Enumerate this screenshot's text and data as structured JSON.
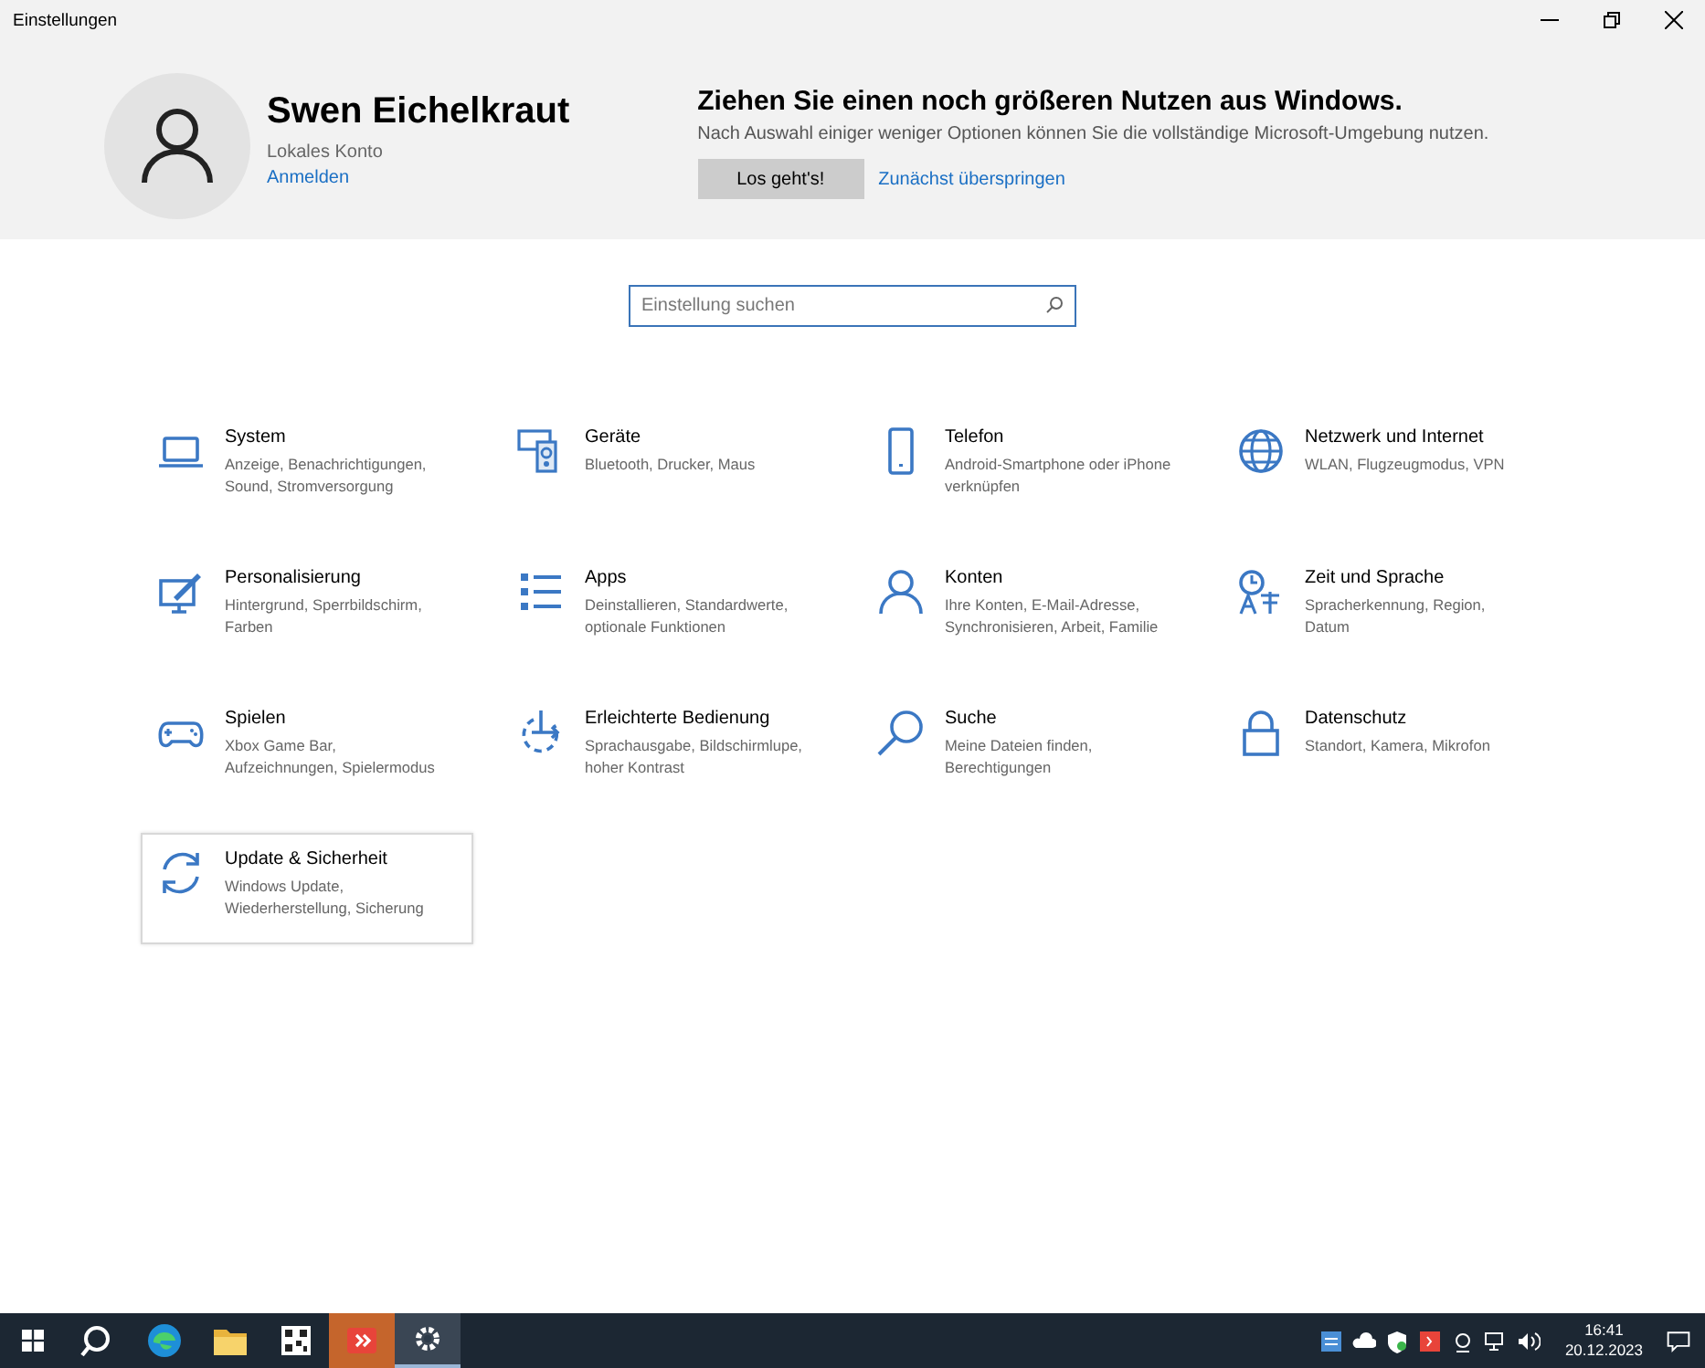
{
  "window": {
    "title": "Einstellungen"
  },
  "account": {
    "name": "Swen Eichelkraut",
    "type": "Lokales Konto",
    "link": "Anmelden"
  },
  "promo": {
    "title": "Ziehen Sie einen noch größeren Nutzen aus Windows.",
    "text": "Nach Auswahl einiger weniger Optionen können Sie die vollständige Microsoft-Umgebung nutzen.",
    "primary": "Los geht's!",
    "secondary": "Zunächst überspringen"
  },
  "search": {
    "placeholder": "Einstellung suchen"
  },
  "tiles": [
    {
      "title": "System",
      "description": "Anzeige, Benachrichtigungen, Sound, Stromversorgung",
      "hovered": false
    },
    {
      "title": "Geräte",
      "description": "Bluetooth, Drucker, Maus",
      "hovered": false
    },
    {
      "title": "Telefon",
      "description": "Android-Smartphone oder iPhone verknüpfen",
      "hovered": false
    },
    {
      "title": "Netzwerk und Internet",
      "description": "WLAN, Flugzeugmodus, VPN",
      "hovered": false
    },
    {
      "title": "Personalisierung",
      "description": "Hintergrund, Sperrbildschirm, Farben",
      "hovered": false
    },
    {
      "title": "Apps",
      "description": "Deinstallieren, Standardwerte, optionale Funktionen",
      "hovered": false
    },
    {
      "title": "Konten",
      "description": "Ihre Konten, E-Mail-Adresse, Synchronisieren, Arbeit, Familie",
      "hovered": false
    },
    {
      "title": "Zeit und Sprache",
      "description": "Spracherkennung, Region, Datum",
      "hovered": false
    },
    {
      "title": "Spielen",
      "description": "Xbox Game Bar, Aufzeichnungen, Spielermodus",
      "hovered": false
    },
    {
      "title": "Erleichterte Bedienung",
      "description": "Sprachausgabe, Bildschirmlupe, hoher Kontrast",
      "hovered": false
    },
    {
      "title": "Suche",
      "description": "Meine Dateien finden, Berechtigungen",
      "hovered": false
    },
    {
      "title": "Datenschutz",
      "description": "Standort, Kamera, Mikrofon",
      "hovered": false
    },
    {
      "title": "Update & Sicherheit",
      "description": "Windows Update, Wiederherstellung, Sicherung",
      "hovered": true
    }
  ],
  "taskbar": {
    "apps": [
      {
        "selected": false,
        "flashing": false
      },
      {
        "selected": false,
        "flashing": false
      },
      {
        "selected": false,
        "flashing": false
      },
      {
        "selected": false,
        "flashing": false
      },
      {
        "selected": false,
        "flashing": true
      },
      {
        "selected": true,
        "flashing": false
      }
    ],
    "time": "16:41",
    "date": "20.12.2023"
  }
}
